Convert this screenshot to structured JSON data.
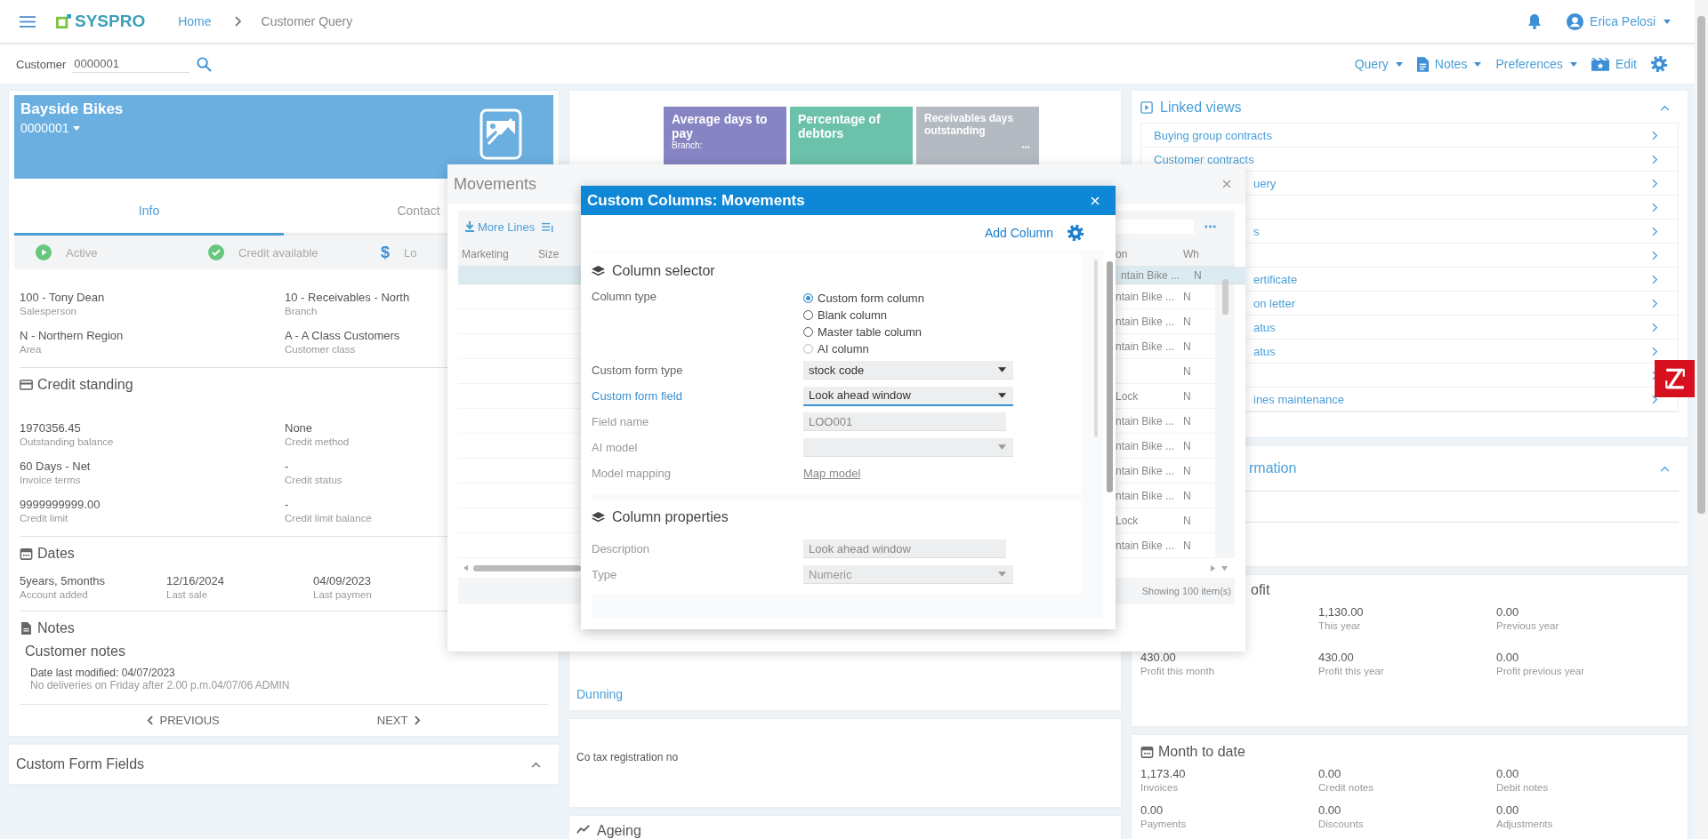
{
  "topbar": {
    "brand": "SYSPRO",
    "breadcrumb": [
      {
        "label": "Home",
        "link": true
      },
      {
        "label": "Customer Query",
        "link": false
      }
    ],
    "user": "Erica Pelosi"
  },
  "toolbar": {
    "customer_label": "Customer",
    "customer_value": "0000001",
    "menus": [
      {
        "label": "Query",
        "kind": "menu"
      },
      {
        "label": "Notes",
        "kind": "notes-menu"
      },
      {
        "label": "Preferences",
        "kind": "menu"
      },
      {
        "label": "Edit",
        "kind": "edit-button"
      }
    ]
  },
  "customer": {
    "name": "Bayside Bikes",
    "code": "0000001",
    "tabs": [
      {
        "label": "Info",
        "selected": true
      },
      {
        "label": "Contact",
        "selected": false
      }
    ],
    "statuses": [
      {
        "label": "Active",
        "kind": "play"
      },
      {
        "label": "Credit available",
        "kind": "check"
      },
      {
        "label": "Lo",
        "kind": "dollar",
        "symbol": "$"
      }
    ],
    "info_fields": [
      {
        "value": "100 - Tony Dean",
        "label": "Salesperson"
      },
      {
        "value": "10 - Receivables - North",
        "label": "Branch"
      },
      {
        "value": "N - Northern Region",
        "label": "Area"
      },
      {
        "value": "A - A Class Customers",
        "label": "Customer class"
      }
    ],
    "credit_standing": {
      "title": "Credit standing",
      "fields": [
        {
          "value": "1970356.45",
          "label": "Outstanding balance"
        },
        {
          "value": "None",
          "label": "Credit method"
        },
        {
          "value": "60 Days - Net",
          "label": "Invoice terms"
        },
        {
          "value": "-",
          "label": "Credit status"
        },
        {
          "value": "9999999999.00",
          "label": "Credit limit"
        },
        {
          "value": "-",
          "label": "Credit limit balance"
        }
      ]
    },
    "dates": {
      "title": "Dates",
      "fields": [
        {
          "value": "5years, 5months",
          "label": "Account added"
        },
        {
          "value": "12/16/2024",
          "label": "Last sale"
        },
        {
          "value": "04/09/2023",
          "label": "Last paymen"
        }
      ]
    },
    "notes": {
      "title": "Notes",
      "heading": "Customer notes",
      "modified": "Date last modified: 04/07/2023",
      "text": "No deliveries on Friday after 2.00 p.m.04/07/06 ADMIN"
    },
    "pager": {
      "previous": "PREVIOUS",
      "next": "NEXT"
    }
  },
  "custom_form_fields": {
    "title": "Custom Form Fields",
    "expanded": true
  },
  "center": {
    "tiles": [
      {
        "title": "Average days to pay",
        "subtitle": "Branch:",
        "color": "#8784c4",
        "has_menu": false
      },
      {
        "title": "Percentage of debtors",
        "color": "#6cc1ab",
        "has_menu": false
      },
      {
        "title": "Receivables days outstanding",
        "color": "#b3bac1",
        "has_menu": true
      }
    ],
    "dunning": "Dunning",
    "tax_label": "Co tax registration no",
    "ageing": "Ageing"
  },
  "linked_views": {
    "title": "Linked views",
    "expanded": true,
    "items": [
      {
        "label": "Buying group contracts",
        "kind": "full"
      },
      {
        "label": "Customer contracts",
        "kind": "full"
      },
      {
        "label": "uery",
        "kind": "partial"
      },
      {
        "kind": "blank"
      },
      {
        "label": "s",
        "kind": "partial"
      },
      {
        "kind": "blank"
      },
      {
        "label": "ertificate",
        "kind": "partial"
      },
      {
        "label": "on letter",
        "kind": "partial"
      },
      {
        "label": "atus",
        "kind": "partial"
      },
      {
        "label": "atus",
        "kind": "partial"
      },
      {
        "kind": "blank"
      },
      {
        "label": "ines maintenance",
        "kind": "partial"
      }
    ]
  },
  "information": {
    "title": "rmation",
    "expanded": true
  },
  "profit": {
    "title": "ofit",
    "rows": [
      [
        "",
        {
          "value": "1,130.00",
          "label": "This year"
        },
        {
          "value": "0.00",
          "label": "Previous year"
        }
      ],
      [
        {
          "value": "430.00",
          "label": "Profit this month"
        },
        {
          "value": "430.00",
          "label": "Profit this year"
        },
        {
          "value": "0.00",
          "label": "Profit previous year"
        }
      ]
    ]
  },
  "month_to_date": {
    "title": "Month to date",
    "fields": [
      {
        "value": "1,173.40",
        "label": "Invoices"
      },
      {
        "value": "0.00",
        "label": "Credit notes"
      },
      {
        "value": "0.00",
        "label": "Debit notes"
      },
      {
        "value": "0.00",
        "label": "Payments"
      },
      {
        "value": "0.00",
        "label": "Discounts"
      },
      {
        "value": "0.00",
        "label": "Adjustments"
      }
    ]
  },
  "movements": {
    "title": "Movements",
    "more_lines": "More Lines",
    "columns_left": [
      "Marketing",
      "Size"
    ],
    "columns_right": [
      "on",
      "Wh"
    ],
    "rows": [
      {
        "description": "ntain Bike ...",
        "wh": "N",
        "selected": true
      },
      {
        "description": "ntain Bike ...",
        "wh": "N",
        "selected": false
      },
      {
        "description": "ntain Bike ...",
        "wh": "N",
        "selected": false
      },
      {
        "description": "ntain Bike ...",
        "wh": "N",
        "selected": false
      },
      {
        "wh": "N",
        "selected": false
      },
      {
        "description": "Lock",
        "wh": "N",
        "selected": false
      },
      {
        "description": "ntain Bike ...",
        "wh": "N",
        "selected": false
      },
      {
        "description": "ntain Bike ...",
        "wh": "N",
        "selected": false
      },
      {
        "description": "ntain Bike ...",
        "wh": "N",
        "selected": false
      },
      {
        "description": "ntain Bike ...",
        "wh": "N",
        "selected": false
      },
      {
        "description": "Lock",
        "wh": "N",
        "selected": false
      },
      {
        "description": "ntain Bike ...",
        "wh": "N",
        "selected": false
      }
    ],
    "footer": "Showing 100 item(s)"
  },
  "dialog": {
    "title": "Custom Columns: Movements",
    "add_column": "Add Column",
    "selector": {
      "title": "Column selector",
      "column_type_label": "Column type",
      "options": [
        {
          "label": "Custom form column",
          "selected": true,
          "disabled": false
        },
        {
          "label": "Blank column",
          "selected": false,
          "disabled": false
        },
        {
          "label": "Master table column",
          "selected": false,
          "disabled": false
        },
        {
          "label": "AI column",
          "selected": false,
          "disabled": true
        }
      ],
      "rows": [
        {
          "label": "Custom form type",
          "kind": "select",
          "value": "stock code",
          "focused": false,
          "disabled": false
        },
        {
          "label": "Custom form field",
          "kind": "select",
          "value": "Look ahead window",
          "focused": true,
          "disabled": false
        },
        {
          "label": "Field name",
          "kind": "readonly",
          "value": "LOO001"
        },
        {
          "label": "AI model",
          "kind": "select",
          "focused": false,
          "disabled": true
        },
        {
          "label": "Model mapping",
          "kind": "link",
          "value": "Map model"
        }
      ]
    },
    "properties": {
      "title": "Column properties",
      "rows": [
        {
          "label": "Description",
          "kind": "readonly",
          "value": "Look ahead window"
        },
        {
          "label": "Type",
          "kind": "select",
          "value": "Numeric",
          "focused": false,
          "disabled": true
        }
      ]
    }
  }
}
